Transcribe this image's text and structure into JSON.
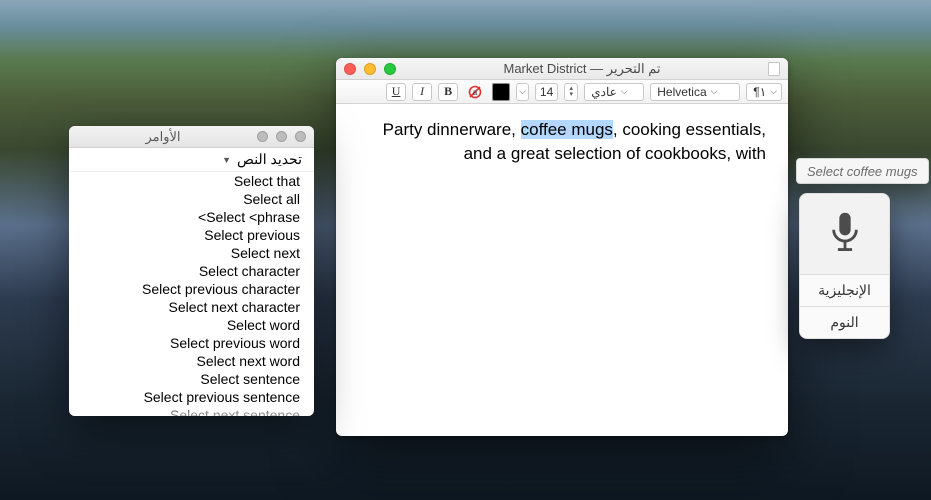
{
  "editor": {
    "title": "Market District — تم التحرير",
    "toolbar": {
      "para_dir": "¶١",
      "font": "Helvetica",
      "weight": "عادي",
      "size": "14",
      "bold": "B",
      "italic": "I",
      "underline": "U"
    },
    "body": {
      "before": "Party dinnerware, ",
      "selected": "coffee mugs",
      "after": ", cooking essentials, and a great selection of cookbooks, with"
    }
  },
  "bubble": {
    "text": "Select coffee mugs"
  },
  "dictation": {
    "language": "الإنجليزية",
    "state": "النوم"
  },
  "commands": {
    "title": "الأوامر",
    "section": "تحديد النص",
    "items": [
      "Select that",
      "Select all",
      "<Select <phrase",
      "Select previous",
      "Select next",
      "Select character",
      "Select previous character",
      "Select next character",
      "Select word",
      "Select previous word",
      "Select next word",
      "Select sentence",
      "Select previous sentence",
      "Select next sentence"
    ]
  }
}
